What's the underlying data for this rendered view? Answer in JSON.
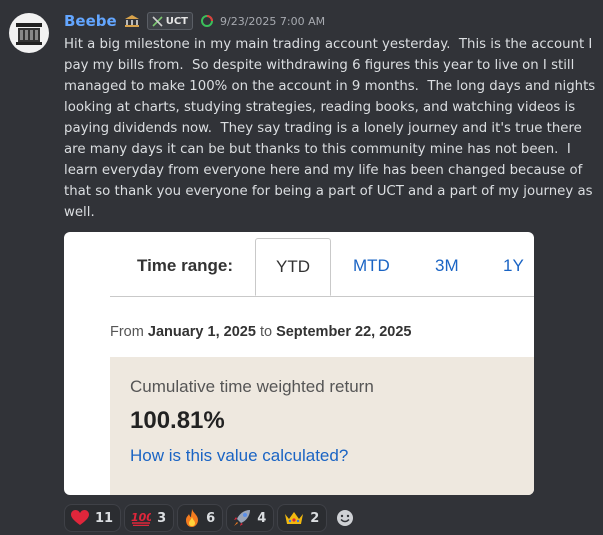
{
  "author": {
    "username": "Beebe",
    "tag": "UCT",
    "timestamp": "9/23/2025 7:00 AM"
  },
  "message": {
    "text": "Hit a big milestone in my main trading account yesterday.  This is the account I pay my bills from.  So despite withdrawing 6 figures this year to live on I still managed to make 100% on the account in 9 months.  The long days and nights looking at charts, studying strategies, reading books, and watching videos is paying dividends now.  They say trading is a lonely journey and it's true there are many days it can be but thanks to this community mine has not been.  I learn everyday from everyone here and my life has been changed because of that so thank you everyone for being a part of UCT and a part of my journey as well."
  },
  "embed": {
    "time_range_label": "Time range:",
    "tabs": [
      "YTD",
      "MTD",
      "3M",
      "1Y"
    ],
    "active_tab": "YTD",
    "from_prefix": "From",
    "from_date": "January 1, 2025",
    "to_word": "to",
    "to_date": "September 22, 2025",
    "return_label": "Cumulative time weighted return",
    "return_value": "100.81%",
    "help_link": "How is this value calculated?"
  },
  "reactions": [
    {
      "emoji": "red-heart",
      "count": "11"
    },
    {
      "emoji": "hundred-points",
      "count": "3"
    },
    {
      "emoji": "fire",
      "count": "6"
    },
    {
      "emoji": "rocket",
      "count": "4"
    },
    {
      "emoji": "crown",
      "count": "2"
    }
  ],
  "colors": {
    "background": "#313338",
    "username": "#63a6ff",
    "link": "#1a64c4",
    "return_box": "#eee8df"
  }
}
